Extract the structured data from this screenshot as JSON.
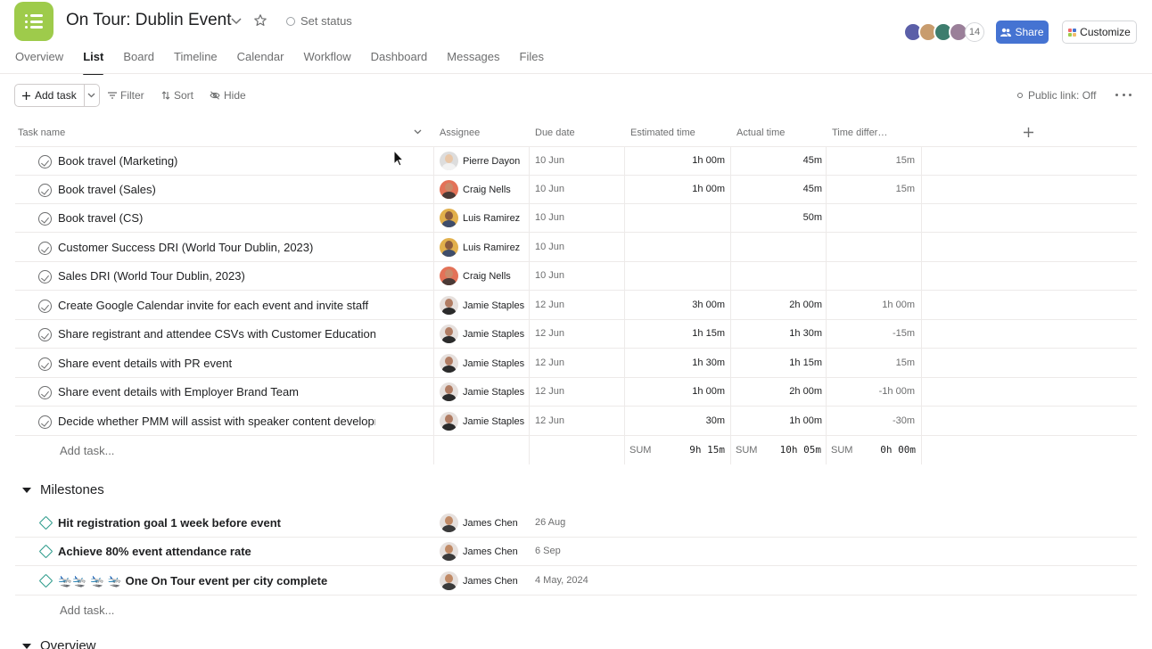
{
  "header": {
    "title": "On Tour: Dublin Event",
    "set_status": "Set status",
    "member_count": "14",
    "share_label": "Share",
    "customize_label": "Customize",
    "brand_color": "#9ecb4b",
    "share_color": "#4573d2"
  },
  "tabs": [
    "Overview",
    "List",
    "Board",
    "Timeline",
    "Calendar",
    "Workflow",
    "Dashboard",
    "Messages",
    "Files"
  ],
  "active_tab": "List",
  "toolbar": {
    "add_task": "Add task",
    "filter": "Filter",
    "sort": "Sort",
    "hide": "Hide",
    "public_link": "Public link: Off"
  },
  "columns": {
    "task_name": "Task name",
    "assignee": "Assignee",
    "due_date": "Due date",
    "estimated": "Estimated time",
    "actual": "Actual time",
    "difference": "Time differ…"
  },
  "tasks": [
    {
      "name": "Book travel (Marketing)",
      "assignee": "Pierre Dayon",
      "due": "10 Jun",
      "est": "1h 00m",
      "act": "45m",
      "diff": "15m"
    },
    {
      "name": "Book travel (Sales)",
      "assignee": "Craig Nells",
      "due": "10 Jun",
      "est": "1h 00m",
      "act": "45m",
      "diff": "15m"
    },
    {
      "name": "Book travel (CS)",
      "assignee": "Luis Ramirez",
      "due": "10 Jun",
      "est": "",
      "act": "50m",
      "diff": ""
    },
    {
      "name": "Customer Success DRI (World Tour Dublin, 2023)",
      "assignee": "Luis Ramirez",
      "due": "10 Jun",
      "est": "",
      "act": "",
      "diff": ""
    },
    {
      "name": "Sales DRI (World Tour Dublin, 2023)",
      "assignee": "Craig Nells",
      "due": "10 Jun",
      "est": "",
      "act": "",
      "diff": ""
    },
    {
      "name": "Create Google Calendar invite for each event and invite staff",
      "assignee": "Jamie Staples",
      "due": "12 Jun",
      "est": "3h 00m",
      "act": "2h 00m",
      "diff": "1h 00m"
    },
    {
      "name": "Share registrant and attendee CSVs with Customer Education",
      "assignee": "Jamie Staples",
      "due": "12 Jun",
      "est": "1h 15m",
      "act": "1h 30m",
      "diff": "-15m"
    },
    {
      "name": "Share event details with PR event",
      "assignee": "Jamie Staples",
      "due": "12 Jun",
      "est": "1h 30m",
      "act": "1h 15m",
      "diff": "15m"
    },
    {
      "name": "Share event details with Employer Brand Team",
      "assignee": "Jamie Staples",
      "due": "12 Jun",
      "est": "1h 00m",
      "act": "2h 00m",
      "diff": "-1h 00m"
    },
    {
      "name": "Decide whether PMM will assist with speaker content development",
      "assignee": "Jamie Staples",
      "due": "12 Jun",
      "est": "30m",
      "act": "1h 00m",
      "diff": "-30m"
    }
  ],
  "add_task_link": "Add task...",
  "sums": {
    "label": "SUM",
    "est": "9h 15m",
    "act": "10h 05m",
    "diff": "0h 00m"
  },
  "milestones_section": {
    "title": "Milestones",
    "items": [
      {
        "name": "Hit registration goal 1 week before event",
        "assignee": "James Chen",
        "due": "26 Aug"
      },
      {
        "name": "Achieve 80% event attendance rate",
        "assignee": "James Chen",
        "due": "6 Sep"
      },
      {
        "name": "🛬🛬 🛬 🛬 One On Tour event per city complete",
        "assignee": "James Chen",
        "due": "4 May, 2024"
      }
    ],
    "add_task_link": "Add task..."
  },
  "overview_section": {
    "title": "Overview"
  }
}
